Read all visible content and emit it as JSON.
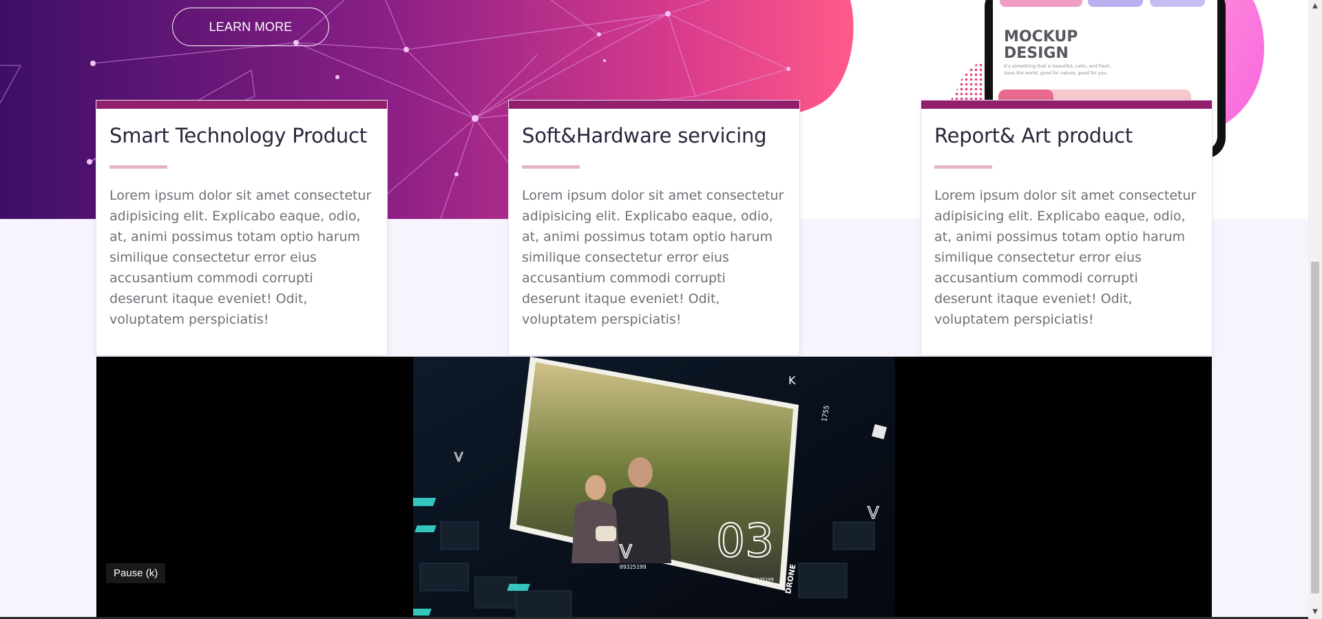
{
  "hero": {
    "learn_more_label": "LEARN MORE"
  },
  "mockup": {
    "title_line1": "MOCKUP",
    "title_line2": "DESIGN",
    "tagline_line1": "It's something that is beautiful, calm, and fresh.",
    "tagline_line2": "Save the world, good for nature, good for you."
  },
  "cards": [
    {
      "title": "Smart Technology Product",
      "text": "Lorem ipsum dolor sit amet consectetur adipisicing elit. Explicabo eaque, odio, at, animi possimus totam optio harum similique consectetur error eius accusantium commodi corrupti deserunt itaque eveniet! Odit, voluptatem perspiciatis!"
    },
    {
      "title": "Soft&Hardware servicing",
      "text": "Lorem ipsum dolor sit amet consectetur adipisicing elit. Explicabo eaque, odio, at, animi possimus totam optio harum similique consectetur error eius accusantium commodi corrupti deserunt itaque eveniet! Odit, voluptatem perspiciatis!"
    },
    {
      "title": "Report& Art product",
      "text": "Lorem ipsum dolor sit amet consectetur adipisicing elit. Explicabo eaque, odio, at, animi possimus totam optio harum similique consectetur error eius accusantium commodi corrupti deserunt itaque eveniet! Odit, voluptatem perspiciatis!"
    }
  ],
  "video": {
    "pause_tooltip": "Pause (k)",
    "overlay_number": "03",
    "code_left": "09325199",
    "code_right": "09325199",
    "label_k": "K",
    "label_v": "V",
    "label_drone": "DRONE",
    "side_number": "1755"
  },
  "colors": {
    "card_border": "#921f6b",
    "divider": "#e6b4c4",
    "hero_start": "#3d0f66",
    "hero_end": "#ff5a8a",
    "bg_lavender": "#f7f4fd"
  }
}
